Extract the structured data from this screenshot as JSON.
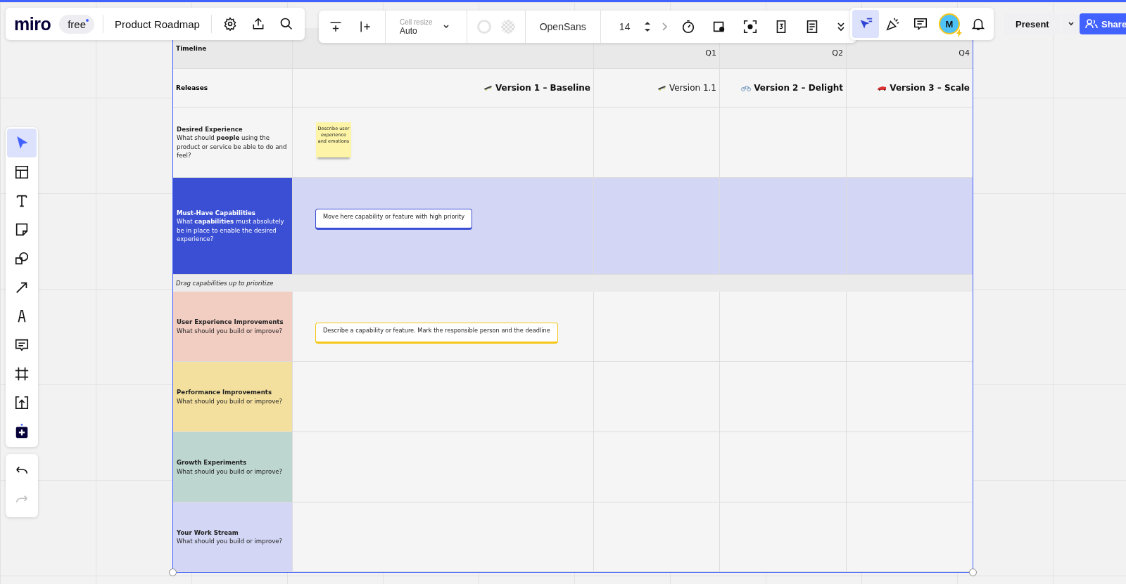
{
  "top_bar": {
    "logo": "miro",
    "plan": "free",
    "board_title": "Product Roadmap"
  },
  "table_toolbar": {
    "cell_resize_label": "Cell resize",
    "cell_resize_value": "Auto",
    "font": "OpenSans",
    "font_size": "14"
  },
  "collab_toolbar": {
    "tools": [
      {
        "selected": true
      },
      {
        "selected": false
      },
      {
        "selected": false
      }
    ],
    "avatar_initial": "M",
    "present": "Present",
    "share": "Share"
  },
  "left_toolbar": {
    "tools": [
      {
        "selected": true
      },
      {
        "selected": false
      },
      {
        "selected": false
      },
      {
        "selected": false
      },
      {
        "selected": false
      },
      {
        "selected": false
      },
      {
        "selected": false
      },
      {
        "selected": false
      },
      {
        "selected": false
      },
      {
        "selected": false
      },
      {
        "selected": false
      }
    ],
    "history": [
      {
        "disabled": false
      },
      {
        "disabled": true
      }
    ]
  },
  "table": {
    "timeline": {
      "label": "Timeline",
      "quarters": [
        {
          "label": "Q1"
        },
        {
          "label": "Q2"
        },
        {
          "label": "Q4"
        }
      ]
    },
    "releases": {
      "label": "Releases",
      "items": [
        {
          "name": "Version 1 – Baseline",
          "bold": true
        },
        {
          "name": "Version 1.1",
          "bold": false
        },
        {
          "name": "Version 2 – Delight",
          "bold": true
        },
        {
          "name": "Version 3 – Scale",
          "bold": true
        }
      ]
    },
    "lanes": [
      {
        "kind": "lane",
        "title": "Desired Experience",
        "text": "What should **people** using the product or service be able to do and feel?",
        "color": "#f5f5f5",
        "highlighted": false,
        "items": [
          {
            "kind": "sticky",
            "text": "Describe user experience and emotions"
          }
        ]
      },
      {
        "kind": "lane",
        "title": "Must-Have Capabilities",
        "text": "What **capabilities** must absolutely be in place to enable the desired experience?",
        "color": "#3b4fd4",
        "highlighted": true,
        "items": [
          {
            "kind": "card",
            "text": "Move here capability or feature with high priority",
            "color": "#3b4fd4"
          }
        ]
      },
      {
        "kind": "note",
        "text": "Drag capabilities up to prioritize"
      },
      {
        "kind": "lane",
        "title": "User Experience Improvements",
        "text": "What should you build or improve?",
        "color": "#f2cdc2",
        "highlighted": false,
        "items": [
          {
            "kind": "card",
            "text": "Describe a capability or feature. Mark the responsible person and the deadline",
            "color": "#f5c518"
          }
        ]
      },
      {
        "kind": "lane",
        "title": "Performance Improvements",
        "text": "What should you build or improve?",
        "color": "#f4e09e",
        "highlighted": false
      },
      {
        "kind": "lane",
        "title": "Growth Experiments",
        "text": "What should you build or improve?",
        "color": "#bdd6cf",
        "highlighted": false
      },
      {
        "kind": "lane",
        "title": "Your Work Stream",
        "text": "What should you build or improve?",
        "color": "#d3d6f4",
        "highlighted": false
      }
    ]
  }
}
